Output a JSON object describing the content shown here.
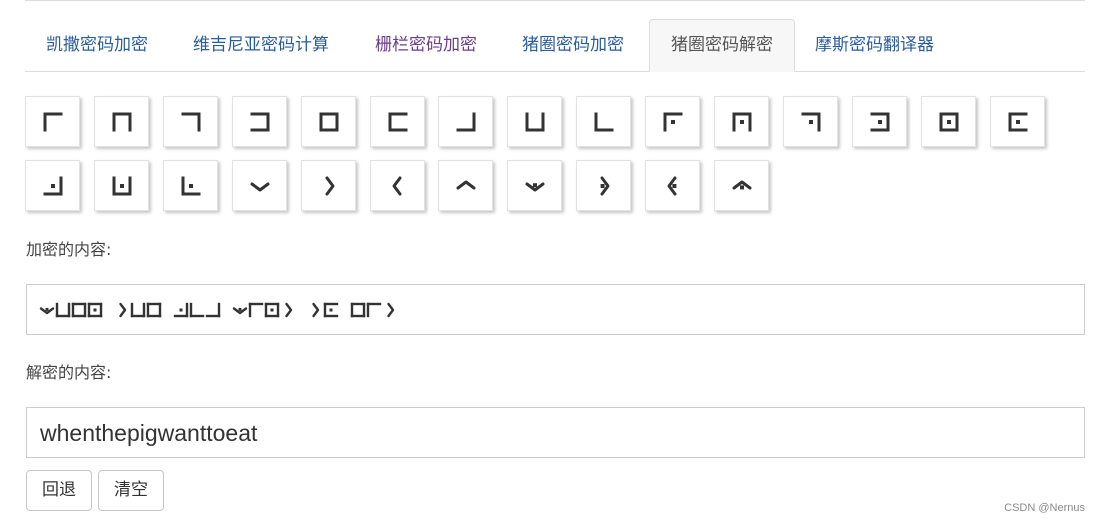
{
  "tabs": [
    {
      "label": "凯撒密码加密",
      "state": "normal"
    },
    {
      "label": "维吉尼亚密码计算",
      "state": "normal"
    },
    {
      "label": "栅栏密码加密",
      "state": "visited"
    },
    {
      "label": "猪圈密码加密",
      "state": "normal"
    },
    {
      "label": "猪圈密码解密",
      "state": "active"
    },
    {
      "label": "摩斯密码翻译器",
      "state": "normal"
    }
  ],
  "keys_row1": [
    {
      "letter": "a",
      "icon": "pigpen-a-icon"
    },
    {
      "letter": "b",
      "icon": "pigpen-b-icon"
    },
    {
      "letter": "c",
      "icon": "pigpen-c-icon"
    },
    {
      "letter": "d",
      "icon": "pigpen-d-icon"
    },
    {
      "letter": "e",
      "icon": "pigpen-e-icon"
    },
    {
      "letter": "f",
      "icon": "pigpen-f-icon"
    },
    {
      "letter": "g",
      "icon": "pigpen-g-icon"
    },
    {
      "letter": "h",
      "icon": "pigpen-h-icon"
    },
    {
      "letter": "i",
      "icon": "pigpen-i-icon"
    },
    {
      "letter": "j",
      "icon": "pigpen-j-icon"
    },
    {
      "letter": "k",
      "icon": "pigpen-k-icon"
    },
    {
      "letter": "l",
      "icon": "pigpen-l-icon"
    },
    {
      "letter": "m",
      "icon": "pigpen-m-icon"
    },
    {
      "letter": "n",
      "icon": "pigpen-n-icon"
    },
    {
      "letter": "o",
      "icon": "pigpen-o-icon"
    }
  ],
  "keys_row2": [
    {
      "letter": "p",
      "icon": "pigpen-p-icon"
    },
    {
      "letter": "q",
      "icon": "pigpen-q-icon"
    },
    {
      "letter": "r",
      "icon": "pigpen-r-icon"
    },
    {
      "letter": "s",
      "icon": "pigpen-s-icon"
    },
    {
      "letter": "t",
      "icon": "pigpen-t-icon"
    },
    {
      "letter": "u",
      "icon": "pigpen-u-icon"
    },
    {
      "letter": "v",
      "icon": "pigpen-v-icon"
    },
    {
      "letter": "w",
      "icon": "pigpen-w-icon"
    },
    {
      "letter": "x",
      "icon": "pigpen-x-icon"
    },
    {
      "letter": "y",
      "icon": "pigpen-y-icon"
    },
    {
      "letter": "z",
      "icon": "pigpen-z-icon"
    }
  ],
  "encrypted": {
    "label": "加密的内容:",
    "value": "when the pig want to eat"
  },
  "decrypted": {
    "label": "解密的内容:",
    "value": "whenthepigwanttoeat"
  },
  "buttons": {
    "back": "回退",
    "clear": "清空"
  },
  "watermark": "CSDN @Nernus",
  "colors": {
    "tab_link": "#2a5d9b",
    "tab_visited": "#6b3d8c",
    "glyph": "#333333"
  }
}
